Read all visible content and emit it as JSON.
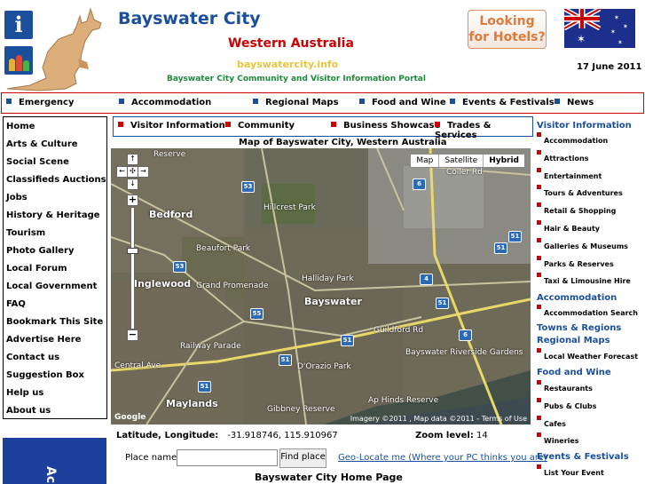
{
  "header": {
    "title": "Bayswater City",
    "subtitle": "Western Australia",
    "domain": "bayswatercity.info",
    "tagline": "Bayswater City Community and Visitor Information Portal",
    "hotels_button": "Looking for Hotels?",
    "date": "17 June 2011",
    "info_glyph": "i"
  },
  "topnav": {
    "items": [
      "Emergency",
      "Accommodation",
      "Regional Maps",
      "Food and Wine",
      "Events & Festivals",
      "News"
    ]
  },
  "leftnav": {
    "items": [
      "Home",
      "Arts & Culture",
      "Social Scene",
      "Classifieds Auctions",
      "Jobs",
      "History & Heritage",
      "Tourism",
      "Photo Gallery",
      "Local Forum",
      "Local Government",
      "FAQ",
      "Bookmark This Site",
      "Advertise Here",
      "Contact us",
      "Suggestion Box",
      "Help us",
      "About us"
    ]
  },
  "banner": {
    "text": "Ac"
  },
  "subnav": {
    "items": [
      "Visitor Information",
      "Community",
      "Business Showcase",
      "Trades & Services"
    ]
  },
  "map": {
    "title": "Map of Bayswater City, Western Australia",
    "type_buttons": [
      "Map",
      "Satellite",
      "Hybrid"
    ],
    "active_type": "Hybrid",
    "labels": [
      "Bedford",
      "Inglewood",
      "Bayswater",
      "Maylands",
      "Hillcrest Park",
      "Beaufort Park",
      "Halliday Park",
      "D'Orazio Park",
      "Gibbney Reserve",
      "Bayswater Riverside Gardens",
      "Ap Hinds Reserve",
      "Reserve",
      "Coller Rd",
      "Guildford Rd",
      "Grand Promenade",
      "Railway Parade",
      "Central Ave"
    ],
    "shields": [
      "53",
      "6",
      "53",
      "55",
      "51",
      "51",
      "4",
      "51",
      "51",
      "6",
      "51",
      "51"
    ],
    "copyright": "Imagery ©2011 , Map data ©2011 - Terms of Use",
    "google": "Google"
  },
  "coords": {
    "label": "Latitude, Longitude:",
    "value": "-31.918746, 115.910967",
    "zoom_label": "Zoom level:",
    "zoom_value": "14"
  },
  "search": {
    "label": "Place name:",
    "value": "",
    "placeholder": "",
    "button": "Find place",
    "geo_link": "Geo-Locate me (Where your PC thinks you are)"
  },
  "home_heading": "Bayswater City Home Page",
  "rightcol": {
    "sections": [
      {
        "heading": "Visitor Information",
        "items": [
          "Accommodation",
          "Attractions",
          "Entertainment",
          "Tours & Adventures",
          "Retail & Shopping",
          "Hair & Beauty",
          "Galleries & Museums",
          "Parks & Reserves",
          "Taxi & Limousine Hire"
        ]
      },
      {
        "heading": "Accommodation",
        "items": [
          "Accommodation Search"
        ]
      },
      {
        "heading": "Towns & Regions",
        "items": []
      },
      {
        "heading": "Regional Maps",
        "items": [
          "Local Weather Forecast"
        ]
      },
      {
        "heading": "Food and Wine",
        "items": [
          "Restaurants",
          "Pubs & Clubs",
          "Cafes",
          "Wineries"
        ]
      },
      {
        "heading": "Events & Festivals",
        "items": [
          "List Your Event"
        ]
      }
    ]
  },
  "colors": {
    "brand_blue": "#1a4f9c",
    "accent_red": "#cc0000",
    "domain_yellow": "#e8c53a",
    "tagline_green": "#1c8a3a",
    "hotels_orange": "#e07a3a"
  }
}
